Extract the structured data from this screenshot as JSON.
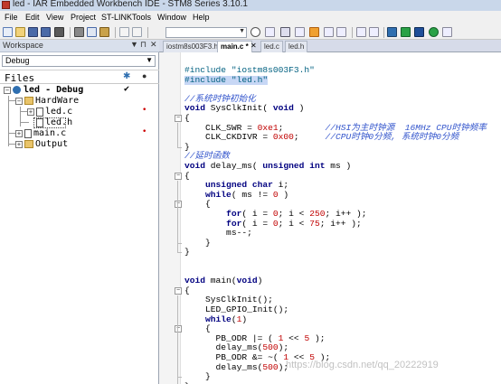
{
  "window": {
    "title": "led - IAR Embedded Workbench IDE - STM8 Series 3.10.1"
  },
  "menu": [
    "File",
    "Edit",
    "View",
    "Project",
    "ST-LINK",
    "Tools",
    "Window",
    "Help"
  ],
  "workspace": {
    "title": "Workspace",
    "config": "Debug",
    "files_header": "Files",
    "tree": [
      {
        "label": "led - Debug",
        "level": 0,
        "kind": "project",
        "check": "✔"
      },
      {
        "label": "HardWare",
        "level": 1,
        "kind": "folder"
      },
      {
        "label": "led.c",
        "level": 2,
        "kind": "file",
        "mark": "•"
      },
      {
        "label": "led.h",
        "level": 2,
        "kind": "file"
      },
      {
        "label": "main.c",
        "level": 1,
        "kind": "file",
        "mark": "•"
      },
      {
        "label": "Output",
        "level": 1,
        "kind": "folder"
      }
    ]
  },
  "editor": {
    "tabs": [
      {
        "label": "iostm8s003F3.h",
        "active": false
      },
      {
        "label": "main.c *",
        "active": true
      },
      {
        "label": "led.c",
        "active": false
      },
      {
        "label": "led.h",
        "active": false
      }
    ],
    "lines": [
      "#include \"iostm8s003F3.h\"",
      "#include \"led.h\"",
      "",
      "//系统时钟初始化",
      "void SysClkInit( void )",
      "{",
      "    CLK_SWR = 0xe1;        //HSI为主时钟源  16MHz CPU时钟频率",
      "    CLK_CKDIVR = 0x00;     //CPU时钟0分频, 系统时钟0分频",
      "}",
      "//延时函数",
      "void delay_ms( unsigned int ms )",
      "{",
      "    unsigned char i;",
      "    while( ms != 0 )",
      "    {",
      "        for( i = 0; i < 250; i++ );",
      "        for( i = 0; i < 75; i++ );",
      "        ms--;",
      "    }",
      "}",
      "",
      "",
      "void main(void)",
      "{",
      "    SysClkInit();",
      "    LED_GPIO_Init();",
      "    while(1)",
      "    {",
      "      PB_ODR |= ( 1 << 5 );",
      "      delay_ms(500);",
      "      PB_ODR &= ~( 1 << 5 );",
      "      delay_ms(500);",
      "    }",
      "}"
    ]
  },
  "watermark": "https://blog.csdn.net/qq_20222919",
  "colors": {
    "keyword": "#000080",
    "comment": "#3355cc",
    "number": "#c00000",
    "preprocessor": "#006080",
    "normal": "#000000"
  }
}
